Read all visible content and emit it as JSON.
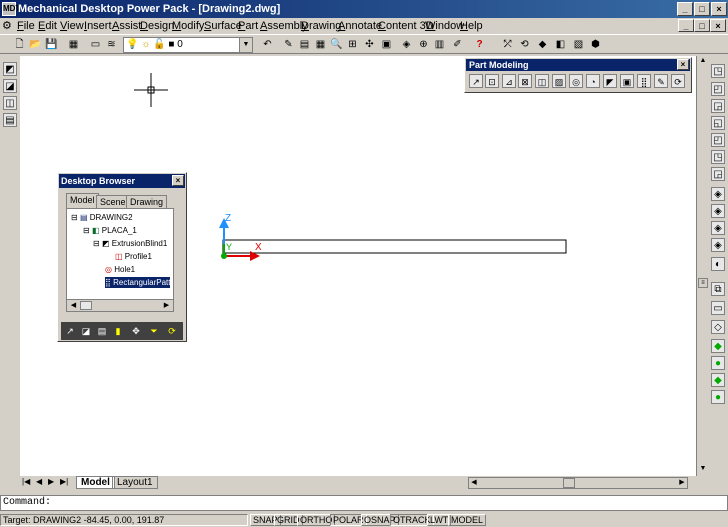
{
  "title": "Mechanical Desktop Power Pack - [Drawing2.dwg]",
  "app_icon": "MDT",
  "window_buttons": [
    "_",
    "□",
    "×"
  ],
  "menu": [
    {
      "ul": "F",
      "rest": "ile"
    },
    {
      "ul": "E",
      "rest": "dit"
    },
    {
      "ul": "V",
      "rest": "iew"
    },
    {
      "ul": "I",
      "rest": "nsert"
    },
    {
      "ul": "A",
      "rest": "ssist"
    },
    {
      "ul": "D",
      "rest": "esign"
    },
    {
      "ul": "M",
      "rest": "odify"
    },
    {
      "ul": "S",
      "rest": "urface"
    },
    {
      "ul": "P",
      "rest": "art"
    },
    {
      "ul": "A",
      "rest": "ssembly"
    },
    {
      "ul": "D",
      "rest": "rawing"
    },
    {
      "ul": "A",
      "rest": "nnotate"
    },
    {
      "ul": "C",
      "rest": "ontent 3D"
    },
    {
      "ul": "W",
      "rest": "indow"
    },
    {
      "ul": "H",
      "rest": "elp"
    }
  ],
  "layer_value": "0",
  "part_modeling": {
    "title": "Part Modeling",
    "close": "×"
  },
  "browser": {
    "title": "Desktop Browser",
    "close": "×",
    "tabs": [
      "Model",
      "Scene",
      "Drawing"
    ],
    "nodes": [
      {
        "toggle": "⊟",
        "icon": "▤",
        "label": "DRAWING2"
      },
      {
        "toggle": "⊟",
        "icon": "◧",
        "label": "PLACA_1"
      },
      {
        "toggle": "⊟",
        "icon": "◩",
        "label": "ExtrusionBlind1"
      },
      {
        "toggle": "",
        "icon": "◫",
        "label": "Profile1"
      },
      {
        "toggle": "",
        "icon": "◎",
        "label": "Hole1"
      },
      {
        "toggle": "",
        "icon": "⣿",
        "label": "RectangularPatt"
      }
    ]
  },
  "ucs": {
    "z": "Z",
    "y": "Y",
    "x": "X"
  },
  "layout_tabs": {
    "model": "Model",
    "layout1": "Layout1"
  },
  "nav_arrows": [
    "|◀",
    "◀",
    "▶",
    "▶|"
  ],
  "command": "Command:",
  "status": {
    "target": "Target: DRAWING2",
    "coords": "-84.45, 0.00, 191.87",
    "toggles": [
      "SNAP",
      "GRID",
      "ORTHO",
      "POLAR",
      "OSNAP",
      "OTRACK",
      "LWT",
      "MODEL"
    ]
  }
}
